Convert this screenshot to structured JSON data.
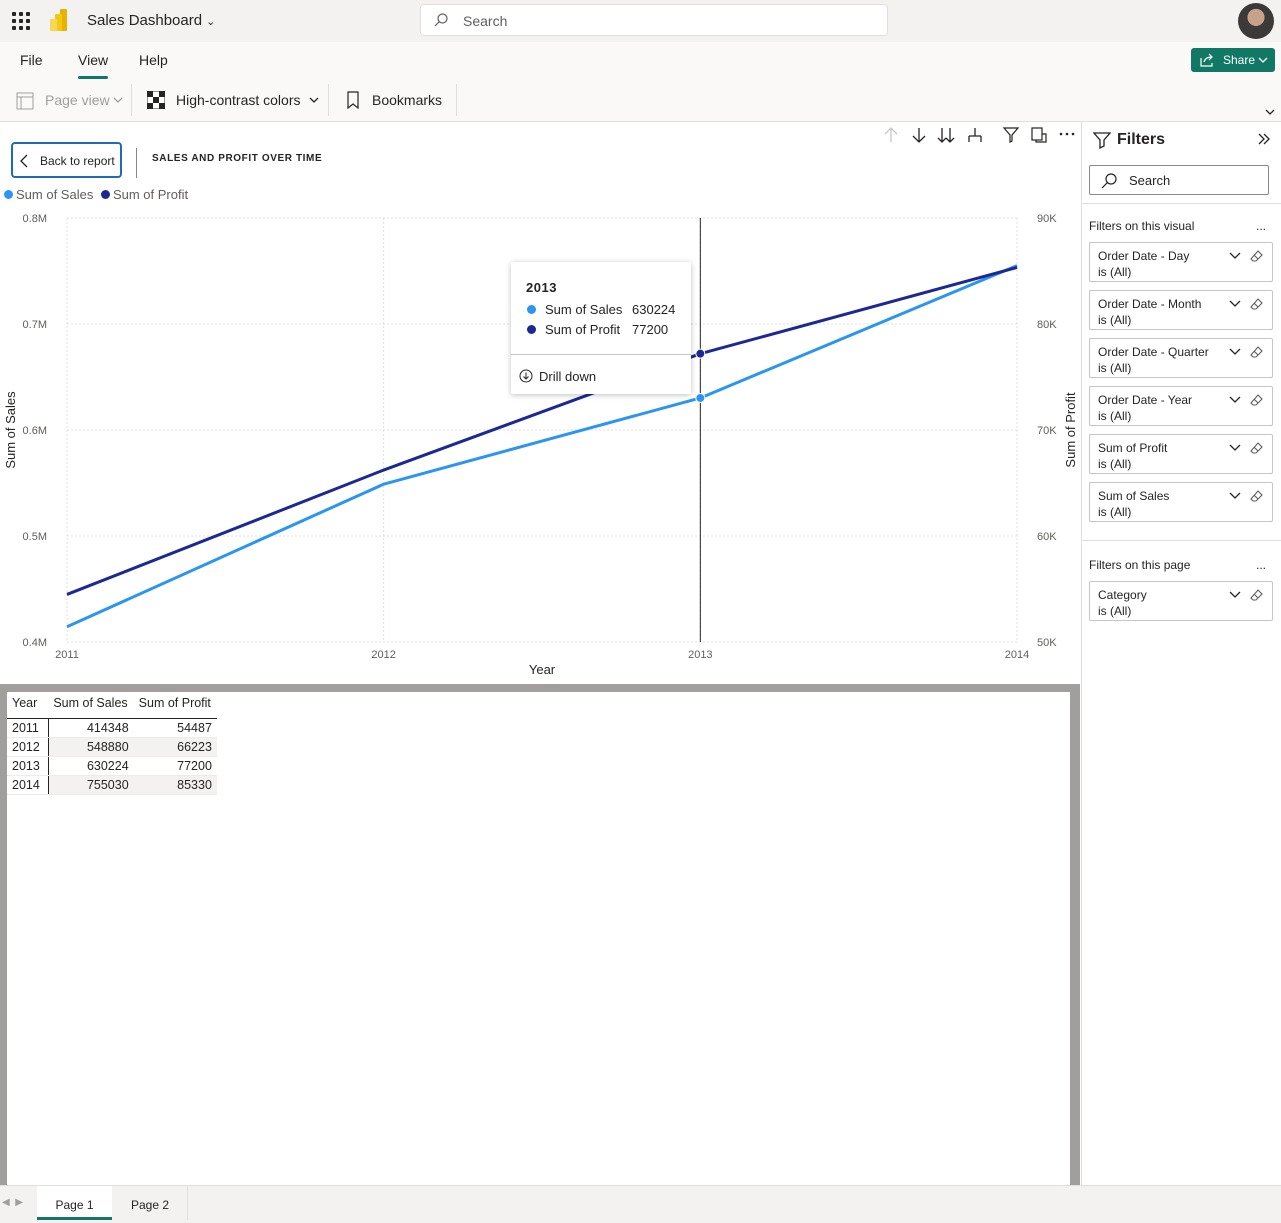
{
  "app": {
    "title": "Sales Dashboard",
    "search_placeholder": "Search"
  },
  "menu": {
    "file": "File",
    "view": "View",
    "help": "Help",
    "share": "Share"
  },
  "ribbon": {
    "page_view": "Page view",
    "high_contrast": "High-contrast colors",
    "bookmarks": "Bookmarks"
  },
  "visual": {
    "back_label": "Back to report",
    "title": "SALES AND PROFIT OVER TIME"
  },
  "tooltip": {
    "title": "2013",
    "rows": [
      {
        "name": "Sum of Sales",
        "value": "630224"
      },
      {
        "name": "Sum of Profit",
        "value": "77200"
      }
    ],
    "drill": "Drill down"
  },
  "chart_data": {
    "type": "line",
    "x": [
      2011,
      2012,
      2013,
      2014
    ],
    "xlabel": "Year",
    "ylabel_left": "Sum of Sales",
    "ylabel_right": "Sum of Profit",
    "ylim_left": [
      400000,
      800000
    ],
    "ylim_right": [
      50000,
      90000
    ],
    "yticks_left": [
      "0.8M",
      "0.7M",
      "0.6M",
      "0.5M",
      "0.4M"
    ],
    "yticks_right": [
      "90K",
      "80K",
      "70K",
      "60K",
      "50K"
    ],
    "xticks": [
      "2011",
      "2012",
      "2013",
      "2014"
    ],
    "legend_position": "top-left",
    "grid": true,
    "series": [
      {
        "name": "Sum of Sales",
        "axis": "left",
        "color": "#2b95f0",
        "values": [
          414348,
          548880,
          630224,
          755030
        ]
      },
      {
        "name": "Sum of Profit",
        "axis": "right",
        "color": "#1c2894",
        "values": [
          54487,
          66223,
          77200,
          85330
        ]
      }
    ],
    "highlight_x": 2013
  },
  "table": {
    "headers": [
      "Year",
      "Sum of Sales",
      "Sum of Profit"
    ],
    "rows": [
      [
        "2011",
        "414348",
        "54487"
      ],
      [
        "2012",
        "548880",
        "66223"
      ],
      [
        "2013",
        "630224",
        "77200"
      ],
      [
        "2014",
        "755030",
        "85330"
      ]
    ]
  },
  "filters": {
    "title": "Filters",
    "search": "Search",
    "visual_section": "Filters on this visual",
    "page_section": "Filters on this page",
    "more": "...",
    "visual_filters": [
      {
        "name": "Order Date - Day",
        "value": "is (All)"
      },
      {
        "name": "Order Date - Month",
        "value": "is (All)"
      },
      {
        "name": "Order Date - Quarter",
        "value": "is (All)"
      },
      {
        "name": "Order Date - Year",
        "value": "is (All)"
      },
      {
        "name": "Sum of Profit",
        "value": "is (All)"
      },
      {
        "name": "Sum of Sales",
        "value": "is (All)"
      }
    ],
    "page_filters": [
      {
        "name": "Category",
        "value": "is (All)"
      }
    ]
  },
  "pages": [
    "Page 1",
    "Page 2"
  ]
}
